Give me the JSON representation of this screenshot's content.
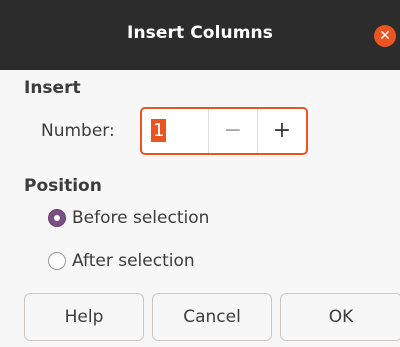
{
  "dialog": {
    "title": "Insert Columns",
    "close_icon": "close-icon",
    "accent_color": "#e95420",
    "titlebar_color": "#2c2c2c"
  },
  "insert": {
    "section_label": "Insert",
    "number_label": "Number:",
    "number_value": "1",
    "decrement_label": "−",
    "increment_label": "+"
  },
  "position": {
    "section_label": "Position",
    "options": [
      {
        "label": "Before selection",
        "checked": true
      },
      {
        "label": "After selection",
        "checked": false
      }
    ]
  },
  "buttons": {
    "help": "Help",
    "cancel": "Cancel",
    "ok": "OK"
  }
}
